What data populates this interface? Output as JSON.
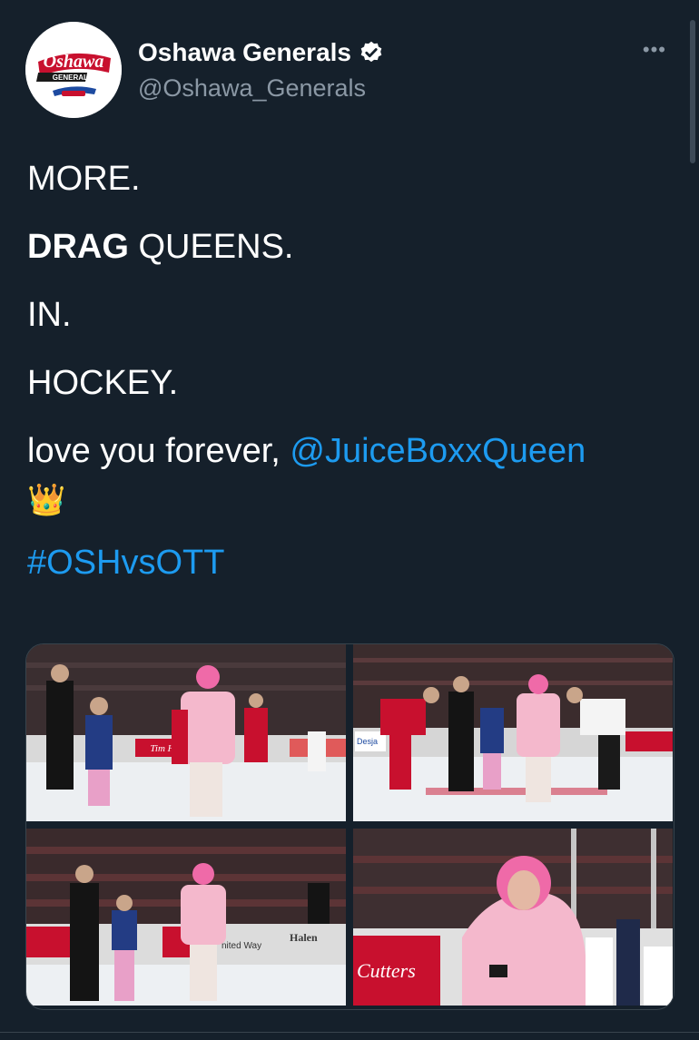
{
  "account": {
    "display_name": "Oshawa Generals",
    "handle": "@Oshawa_Generals",
    "logo_text": "Oshawa",
    "logo_subtext": "GENERALS"
  },
  "more_label": "•••",
  "tweet": {
    "line1": "MORE.",
    "line2_bold": "DRAG",
    "line2_rest": " QUEENS.",
    "line3": "IN.",
    "line4": "HOCKEY.",
    "line5_text": "love you forever, ",
    "mention": "@JuiceBoxxQueen",
    "emoji": "👑",
    "hashtag": "#OSHvsOTT"
  },
  "photos": [
    {
      "sign_text": "Tim H"
    },
    {
      "sign_text": "Desja"
    },
    {
      "sign_text": "nited Way",
      "sign_text_2": "Halen"
    },
    {
      "sign_text": "Cutters"
    }
  ],
  "colors": {
    "background": "#15202b",
    "link": "#1d9bf0",
    "secondary_text": "#8b98a5",
    "generals_red": "#c8102e"
  }
}
